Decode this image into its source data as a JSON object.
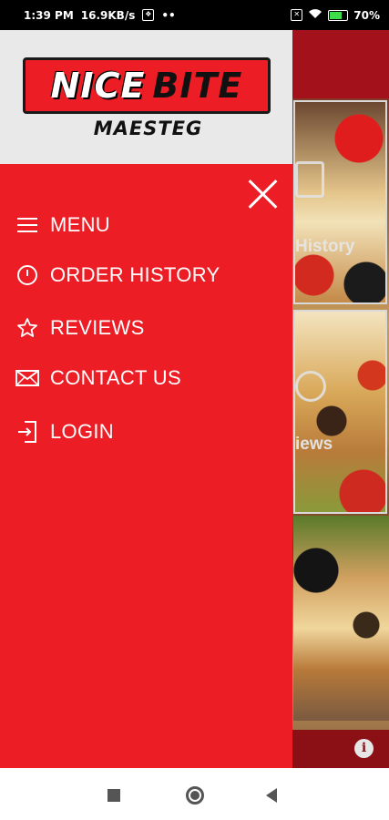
{
  "status_bar": {
    "time": "1:39 PM",
    "speed": "16.9KB/s",
    "dots": "••",
    "battery": "70",
    "battery_level": 0.7
  },
  "background": {
    "tile_labels": [
      "History",
      "iews"
    ]
  },
  "drawer": {
    "logo": {
      "word1": "NICE",
      "word2": "BITE",
      "subtitle": "MAESTEG"
    },
    "items": [
      {
        "label": "MENU",
        "icon": "hamburger-icon"
      },
      {
        "label": "ORDER HISTORY",
        "icon": "clock-icon"
      },
      {
        "label": "REVIEWS",
        "icon": "star-icon"
      },
      {
        "label": "CONTACT US",
        "icon": "envelope-icon"
      },
      {
        "label": "LOGIN",
        "icon": "login-icon"
      }
    ]
  },
  "colors": {
    "drawer_red": "#ec1d25",
    "header_gray": "#e9e9e9",
    "app_footer": "#8a1016"
  }
}
